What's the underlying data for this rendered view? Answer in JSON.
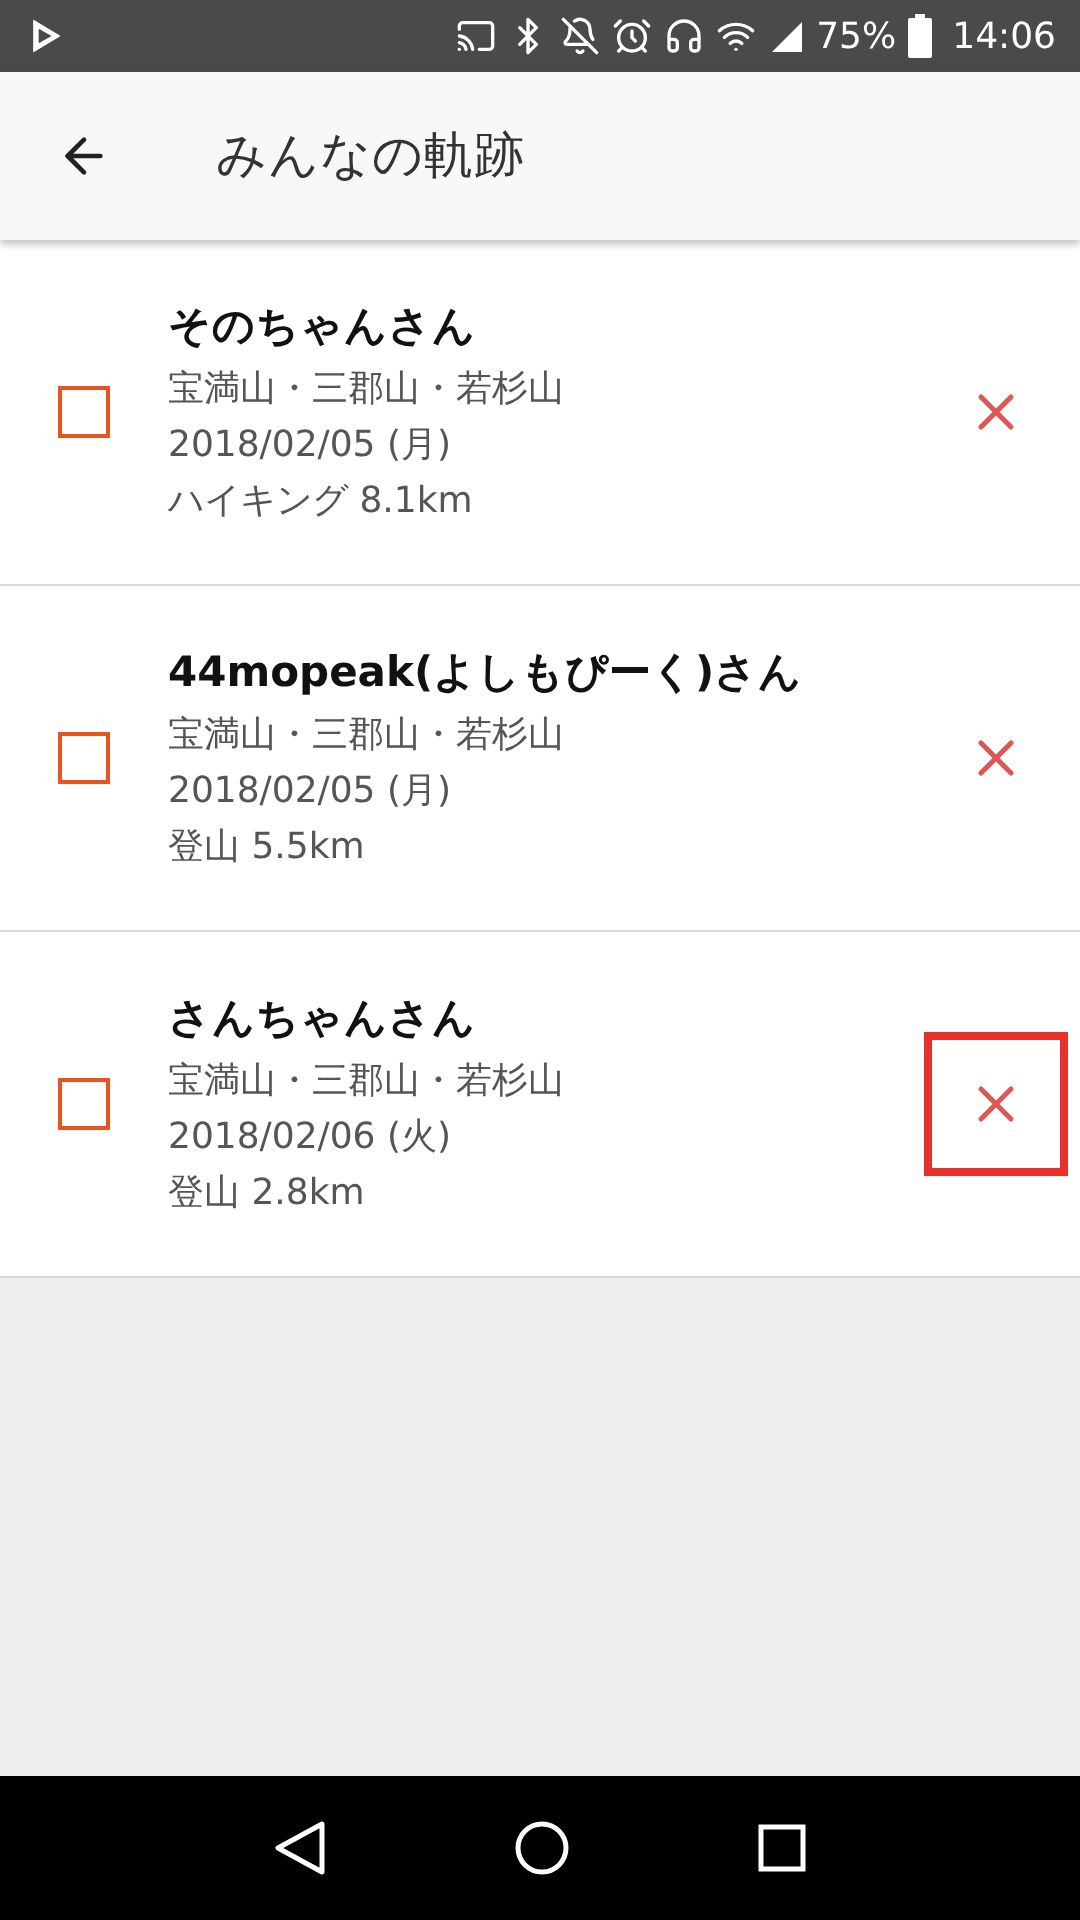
{
  "status_bar": {
    "battery": "75%",
    "time": "14:06"
  },
  "app_bar": {
    "title": "みんなの軌跡"
  },
  "tracks": [
    {
      "name": "そのちゃんさん",
      "place": "宝満山・三郡山・若杉山",
      "date": "2018/02/05 (月)",
      "activity": "ハイキング 8.1km",
      "checked": false,
      "highlighted": false
    },
    {
      "name": "44mopeak(よしもぴーく)さん",
      "place": "宝満山・三郡山・若杉山",
      "date": "2018/02/05 (月)",
      "activity": "登山 5.5km",
      "checked": false,
      "highlighted": false
    },
    {
      "name": "さんちゃんさん",
      "place": "宝満山・三郡山・若杉山",
      "date": "2018/02/06 (火)",
      "activity": "登山 2.8km",
      "checked": false,
      "highlighted": true
    }
  ]
}
